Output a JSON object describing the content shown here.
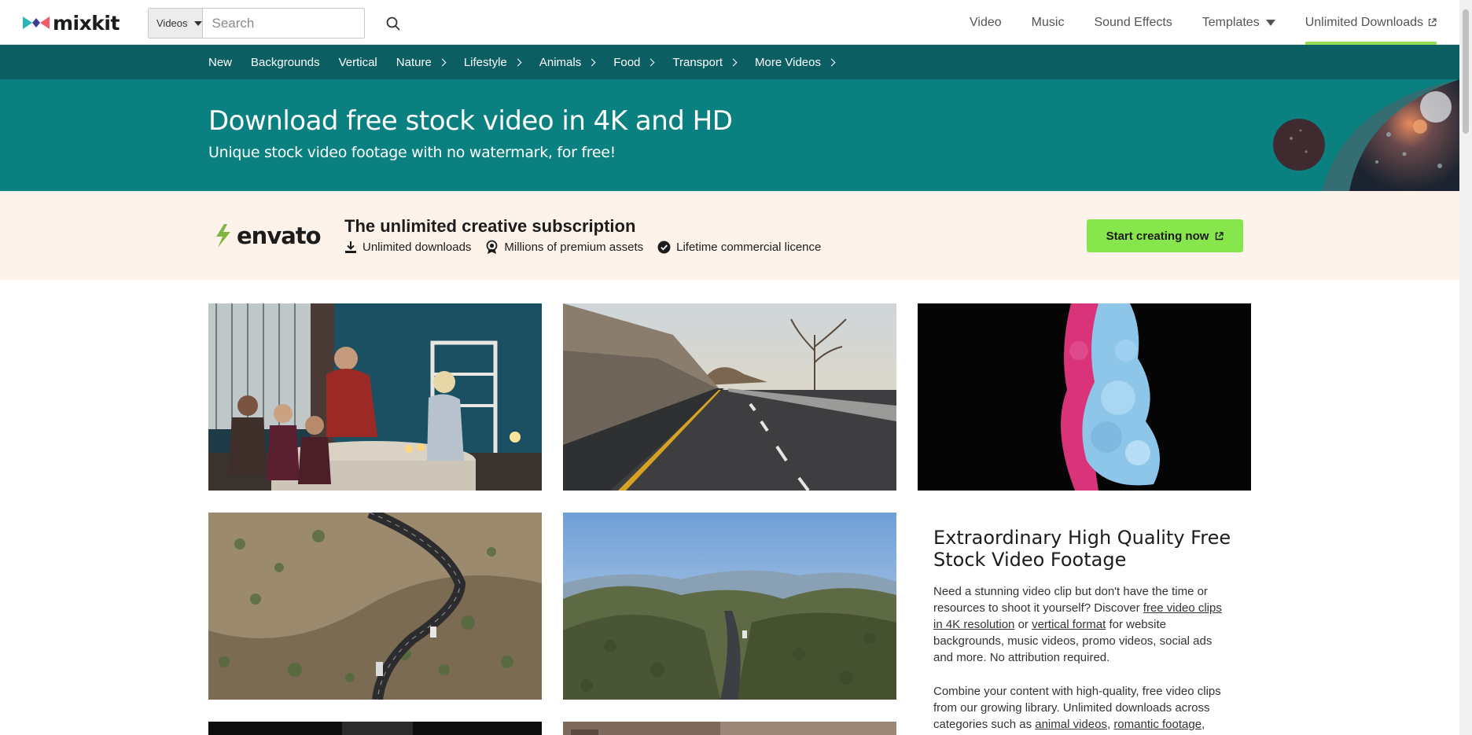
{
  "header": {
    "logo_text": "mixkit",
    "search": {
      "category": "Videos",
      "placeholder": "Search"
    },
    "nav": [
      {
        "label": "Video"
      },
      {
        "label": "Music"
      },
      {
        "label": "Sound Effects"
      },
      {
        "label": "Templates"
      },
      {
        "label": "Unlimited Downloads"
      }
    ]
  },
  "categories": [
    {
      "label": "New",
      "has_submenu": false
    },
    {
      "label": "Backgrounds",
      "has_submenu": false
    },
    {
      "label": "Vertical",
      "has_submenu": false
    },
    {
      "label": "Nature",
      "has_submenu": true
    },
    {
      "label": "Lifestyle",
      "has_submenu": true
    },
    {
      "label": "Animals",
      "has_submenu": true
    },
    {
      "label": "Food",
      "has_submenu": true
    },
    {
      "label": "Transport",
      "has_submenu": true
    },
    {
      "label": "More Videos",
      "has_submenu": true
    }
  ],
  "hero": {
    "title": "Download free stock video in 4K and HD",
    "subtitle": "Unique stock video footage with no watermark, for free!"
  },
  "promo": {
    "logo_text": "envato",
    "title": "The unlimited creative subscription",
    "features": [
      {
        "icon": "download-icon",
        "label": "Unlimited downloads"
      },
      {
        "icon": "award-icon",
        "label": "Millions of premium assets"
      },
      {
        "icon": "check-badge-icon",
        "label": "Lifetime commercial licence"
      }
    ],
    "cta": "Start creating now"
  },
  "videos": [
    {
      "subject": "family-dinner"
    },
    {
      "subject": "highway-road"
    },
    {
      "subject": "ink-in-water"
    },
    {
      "subject": "aerial-mountain-road"
    },
    {
      "subject": "aerial-valley-highway"
    }
  ],
  "article": {
    "title": "Extraordinary High Quality Free Stock Video Footage",
    "p1_a": "Need a stunning video clip but don't have the time or resources to shoot it yourself? Discover ",
    "p1_link1": "free video clips in 4K resolution",
    "p1_b": " or ",
    "p1_link2": "vertical format",
    "p1_c": " for website backgrounds, music videos, promo videos, social ads and more. No attribution required.",
    "p2_a": "Combine your content with high-quality, free video clips from our growing library. Unlimited downloads across categories such as ",
    "p2_link1": "animal videos",
    "p2_b": ", ",
    "p2_link2": "romantic footage",
    "p2_c": ","
  },
  "colors": {
    "catbar_bg": "#0b5f63",
    "hero_bg": "#0a8080",
    "promo_bg": "#fdf3ea",
    "cta_bg": "#87e64b",
    "active_underline": "#92dc56"
  }
}
